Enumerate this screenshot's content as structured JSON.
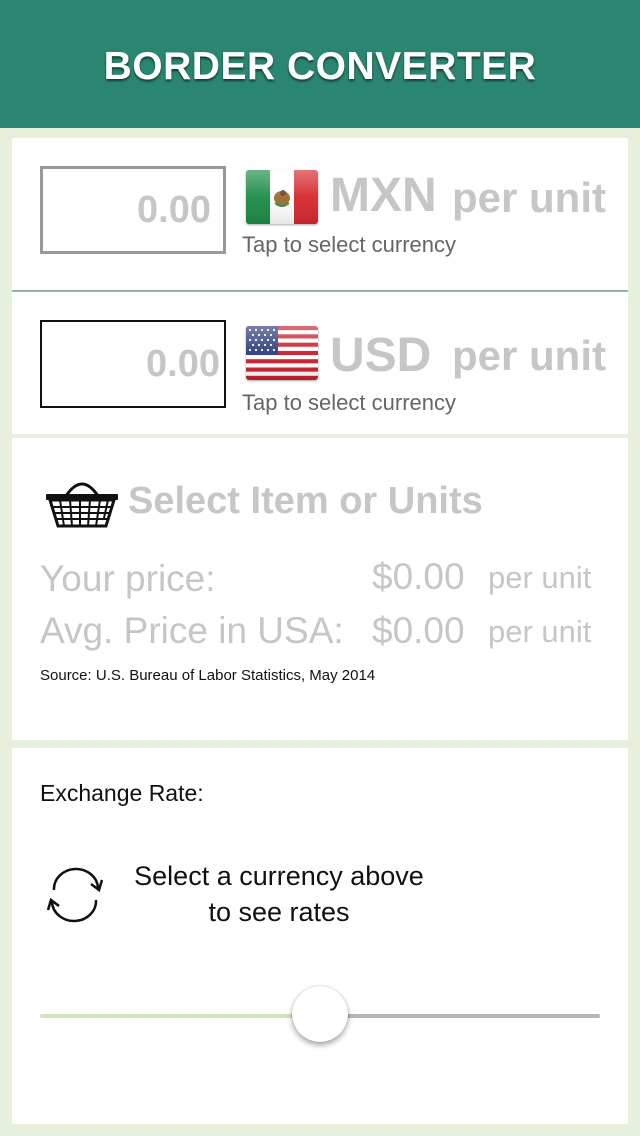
{
  "header": {
    "title": "BORDER CONVERTER"
  },
  "from_currency": {
    "amount": "0.00",
    "code": "MXN",
    "per_unit": "per unit",
    "tap_hint": "Tap to select currency",
    "flag_icon": "mexico-flag-icon"
  },
  "to_currency": {
    "amount": "0.00",
    "code": "USD",
    "per_unit": "per unit",
    "tap_hint": "Tap to select currency",
    "flag_icon": "usa-flag-icon"
  },
  "item": {
    "icon": "basket-icon",
    "select_label": "Select Item or Units",
    "your_price_label": "Your price:",
    "your_price_value": "$0.00",
    "your_price_unit": "per unit",
    "usa_price_label": "Avg. Price in USA:",
    "usa_price_value": "$0.00",
    "usa_price_unit": "per unit",
    "source": "Source: U.S. Bureau of Labor Statistics,  May 2014"
  },
  "exchange": {
    "title": "Exchange Rate:",
    "icon": "refresh-icon",
    "message_line1": "Select a currency above",
    "message_line2": "to see rates",
    "slider_level": 0.5
  },
  "colors": {
    "header_bg": "#2a8571",
    "page_bg": "#e6eedc",
    "placeholder_text": "#c6c6c8",
    "slider_fill": "#cfe5bd",
    "slider_track": "#b6b6b6"
  }
}
